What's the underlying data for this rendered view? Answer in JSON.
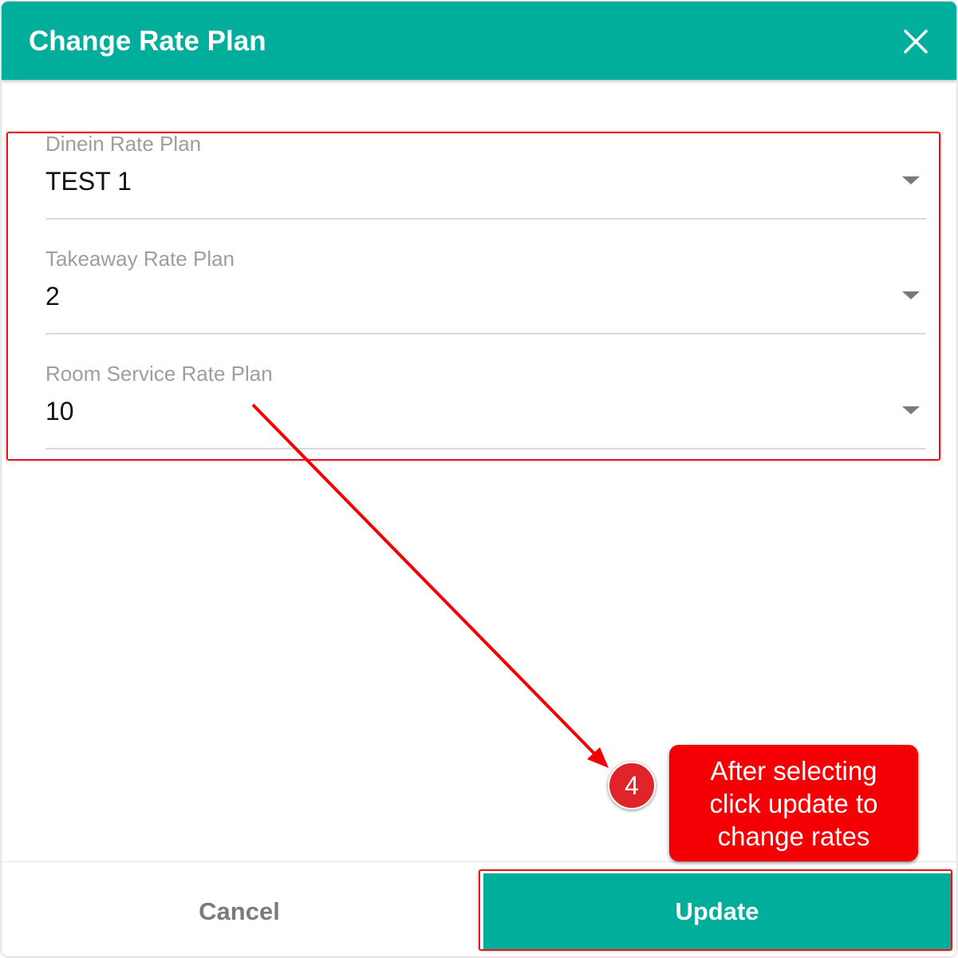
{
  "dialog": {
    "title": "Change Rate Plan",
    "close_icon": "close-icon"
  },
  "fields": [
    {
      "label": "Dinein Rate Plan",
      "value": "TEST 1"
    },
    {
      "label": "Takeaway Rate Plan",
      "value": "2"
    },
    {
      "label": "Room Service Rate Plan",
      "value": "10"
    }
  ],
  "footer": {
    "cancel_label": "Cancel",
    "update_label": "Update"
  },
  "annotation": {
    "step_number": "4",
    "callout_text": "After selecting\nclick update to\nchange rates"
  },
  "colors": {
    "accent": "#00ae9b",
    "annotation_red": "#f40004"
  }
}
